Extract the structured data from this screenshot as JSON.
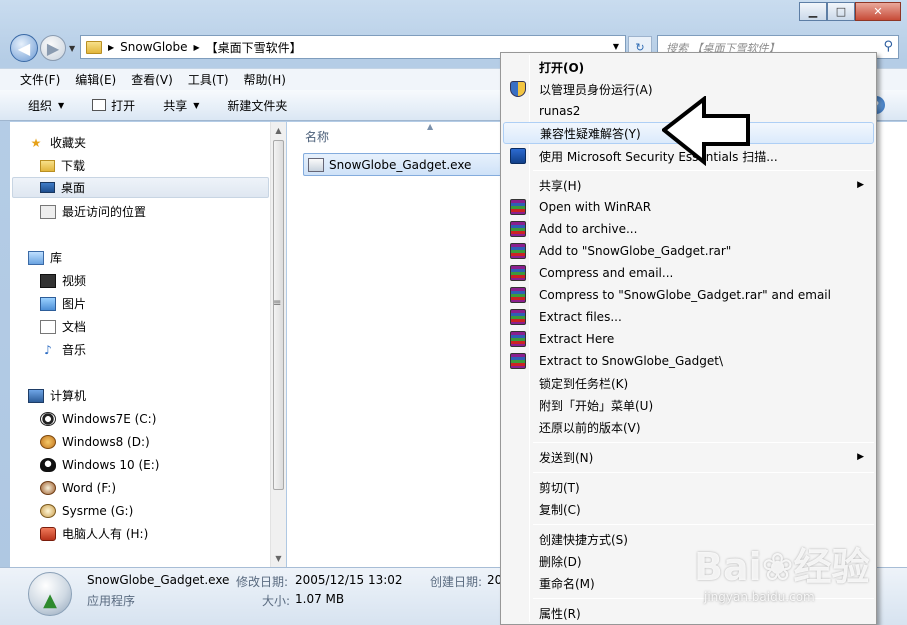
{
  "window": {
    "minimize": "▁",
    "maximize": "□",
    "close": "✕"
  },
  "address": {
    "crumb1": "SnowGlobe",
    "crumb2": "【桌面下雪软件】"
  },
  "search": {
    "placeholder": "搜索 【桌面下雪软件】"
  },
  "menubar": [
    "文件(F)",
    "编辑(E)",
    "查看(V)",
    "工具(T)",
    "帮助(H)"
  ],
  "toolbar": {
    "organize": "组织",
    "open": "打开",
    "share": "共享",
    "new_folder": "新建文件夹"
  },
  "nav_pane": {
    "favorites": "收藏夹",
    "downloads": "下载",
    "desktop": "桌面",
    "recent": "最近访问的位置",
    "libraries": "库",
    "videos": "视频",
    "pictures": "图片",
    "documents": "文档",
    "music": "音乐",
    "computer": "计算机",
    "drives": [
      "Windows7E (C:)",
      "Windows8 (D:)",
      "Windows 10 (E:)",
      "Word (F:)",
      "Sysrme (G:)",
      "电脑人人有 (H:)"
    ]
  },
  "content": {
    "column_name": "名称",
    "file_name": "SnowGlobe_Gadget.exe"
  },
  "details": {
    "file_name": "SnowGlobe_Gadget.exe",
    "file_type": "应用程序",
    "modified_label": "修改日期:",
    "modified_value": "2005/12/15 13:02",
    "created_label": "创建日期:",
    "created_value": "20",
    "size_label": "大小:",
    "size_value": "1.07 MB"
  },
  "context_menu": {
    "open": "打开(O)",
    "run_as_admin": "以管理员身份运行(A)",
    "runas2": "runas2",
    "troubleshoot": "兼容性疑难解答(Y)",
    "mse_scan": "使用 Microsoft Security Essentials 扫描...",
    "share": "共享(H)",
    "winrar_open": "Open with WinRAR",
    "winrar_add": "Add to archive...",
    "winrar_add_named": "Add to \"SnowGlobe_Gadget.rar\"",
    "winrar_compress_email": "Compress and email...",
    "winrar_compress_named_email": "Compress to \"SnowGlobe_Gadget.rar\" and email",
    "winrar_extract_files": "Extract files...",
    "winrar_extract_here": "Extract Here",
    "winrar_extract_to": "Extract to SnowGlobe_Gadget\\",
    "pin_taskbar": "锁定到任务栏(K)",
    "pin_start": "附到「开始」菜单(U)",
    "restore_versions": "还原以前的版本(V)",
    "send_to": "发送到(N)",
    "cut": "剪切(T)",
    "copy": "复制(C)",
    "create_shortcut": "创建快捷方式(S)",
    "delete": "删除(D)",
    "rename": "重命名(M)",
    "properties": "属性(R)"
  },
  "watermark": {
    "brand": "Bai",
    "brand2": "经验",
    "url": "jingyan.baidu.com"
  }
}
